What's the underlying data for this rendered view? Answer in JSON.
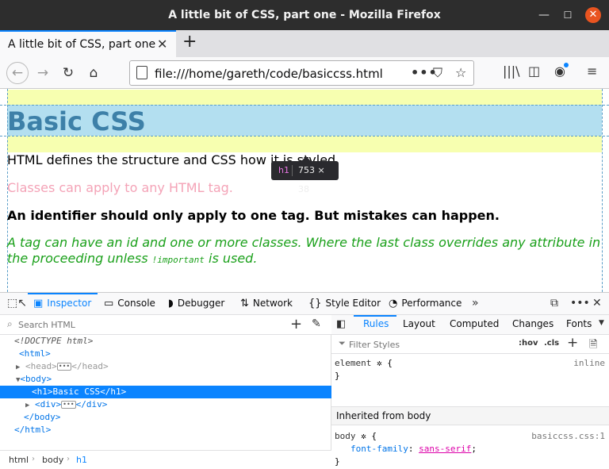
{
  "window": {
    "title": "A little bit of CSS, part one - Mozilla Firefox"
  },
  "tab": {
    "label": "A little bit of CSS, part one"
  },
  "nav": {
    "url": "file:///home/gareth/code/basiccss.html"
  },
  "content": {
    "heading": "Basic CSS",
    "p1": "HTML defines the structure and CSS how it is styled",
    "p2": "Classes can apply to any HTML tag.",
    "p3": "An identifier should only apply to one tag. But mistakes can happen.",
    "p4_before": "A tag can have an id and one or more classes. Where the last class overrides any attribute in the proceeding unless ",
    "p4_code": "!important",
    "p4_after": " is used.",
    "colors": {
      "margin": "#f7ffb0",
      "content_box": "#b3dff0",
      "heading": "#3d80a8",
      "pink": "#f4a3b7",
      "green": "#1aa01a"
    }
  },
  "highlighter": {
    "tag": "h1",
    "size": "753 × 38"
  },
  "devtools": {
    "tabs": [
      "Inspector",
      "Console",
      "Debugger",
      "Network",
      "Style Editor",
      "Performance"
    ],
    "search_placeholder": "Search HTML",
    "tree": {
      "doctype": "<!DOCTYPE html>",
      "html_open": "<html>",
      "head_open": "<head>",
      "head_close": "</head>",
      "body_open": "<body>",
      "h1": "<h1>Basic CSS</h1>",
      "div_open": "<div>",
      "div_close": "</div>",
      "body_close": "</body>",
      "html_close": "</html>"
    },
    "breadcrumbs": [
      "html",
      "body",
      "h1"
    ],
    "right_tabs": [
      "Rules",
      "Layout",
      "Computed",
      "Changes",
      "Fonts"
    ],
    "filter_placeholder": "Filter Styles",
    "hov": ":hov",
    "cls": ".cls",
    "rules": {
      "element_selector": "element",
      "element_source": "inline",
      "inherited_header": "Inherited from body",
      "body_selector": "body",
      "body_source": "basiccss.css:1",
      "prop_name": "font-family",
      "prop_value": "sans-serif"
    }
  }
}
